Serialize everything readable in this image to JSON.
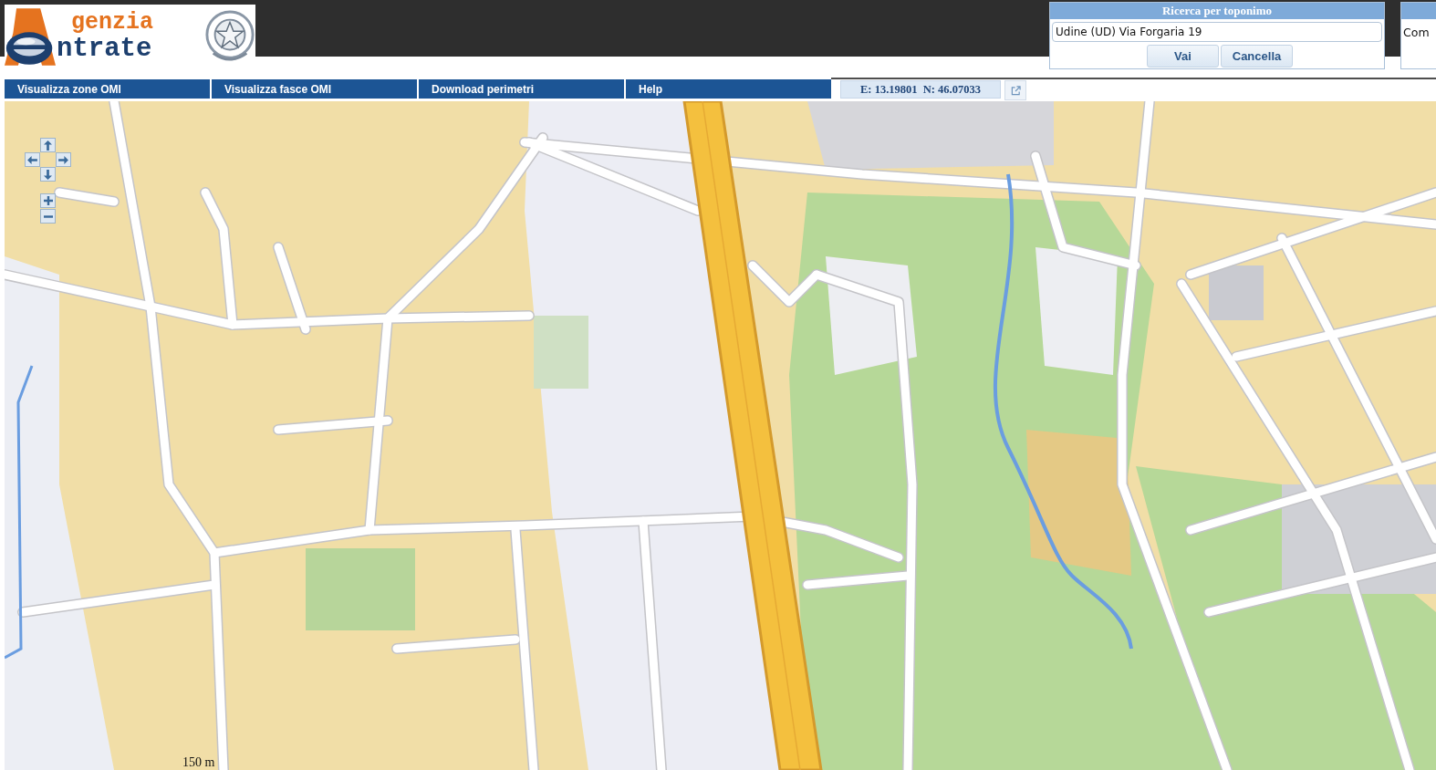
{
  "logo": {
    "line_1": "genzia",
    "line_2": "ntrate"
  },
  "search_panel": {
    "title": "Ricerca per toponimo",
    "value": "Udine (UD) Via Forgaria 19",
    "buttons": [
      "Vai",
      "Cancella"
    ]
  },
  "side_panel": {
    "text": "Com"
  },
  "menu": [
    "Visualizza zone OMI",
    "Visualizza fasce OMI",
    "Download perimetri",
    "Help"
  ],
  "coordinates": "E: 13.19801  N: 46.07033",
  "map": {
    "scale_label": "150 m"
  }
}
